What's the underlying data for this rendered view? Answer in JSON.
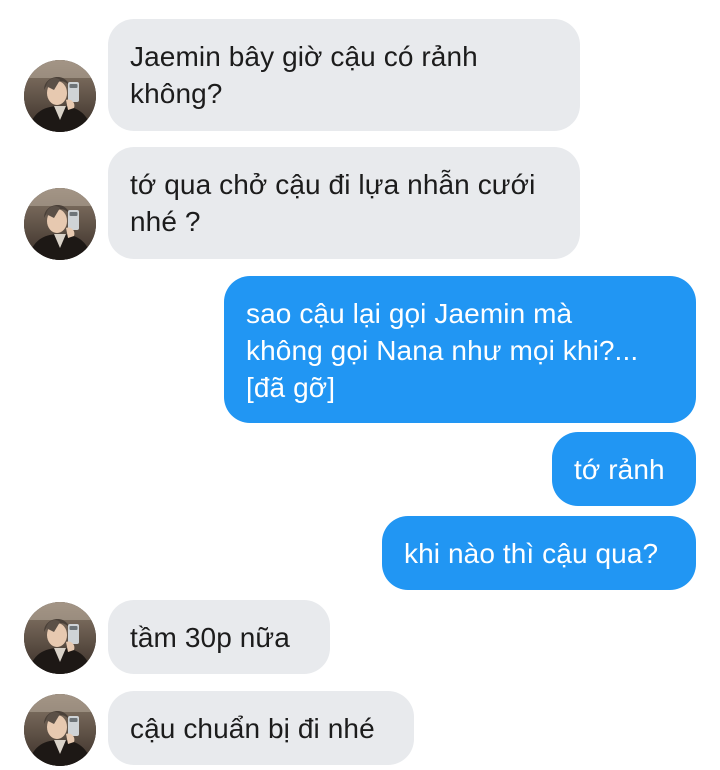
{
  "messages": [
    {
      "side": "in",
      "lines": [
        "Jaemin bây giờ cậu có rảnh",
        "không?"
      ]
    },
    {
      "side": "in",
      "lines": [
        "tớ qua chở cậu đi lựa nhẫn cưới",
        "nhé ?"
      ]
    },
    {
      "side": "out",
      "lines": [
        "sao cậu lại gọi Jaemin mà",
        "không gọi Nana như mọi khi?...",
        "[đã gỡ]"
      ]
    },
    {
      "side": "out",
      "lines": [
        "tớ rảnh"
      ]
    },
    {
      "side": "out",
      "lines": [
        "khi nào thì cậu qua?"
      ]
    },
    {
      "side": "in",
      "lines": [
        "tầm 30p nữa"
      ]
    },
    {
      "side": "in",
      "lines": [
        "cậu chuẩn bị đi nhé"
      ]
    }
  ],
  "colors": {
    "incoming_bubble": "#e8eaed",
    "outgoing_bubble": "#2196f3",
    "incoming_text": "#1c1c1c",
    "outgoing_text": "#ffffff"
  },
  "icons": {
    "contact_avatar": "contact-avatar-photo"
  }
}
